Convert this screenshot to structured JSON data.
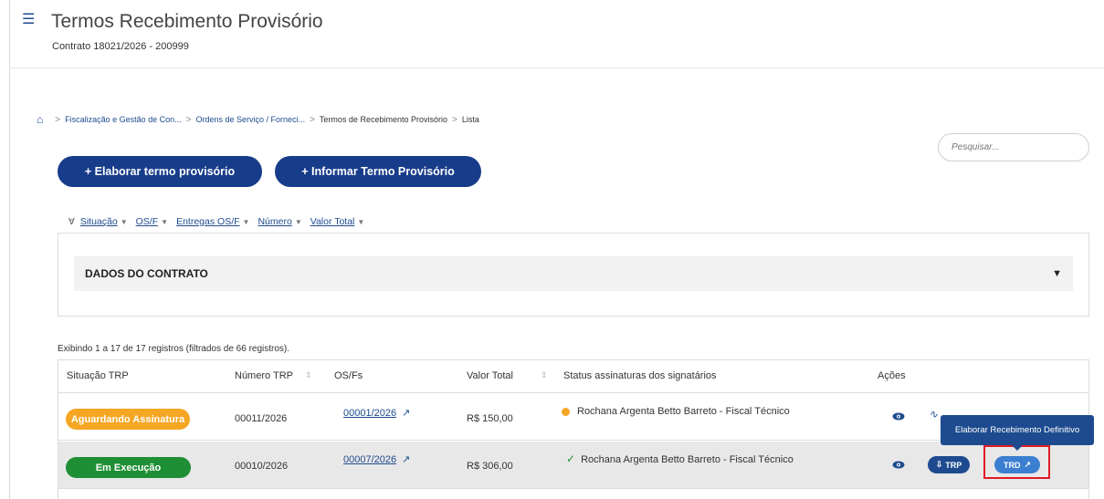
{
  "header": {
    "title": "Termos Recebimento Provisório",
    "subtitle": "Contrato 18021/2026 - 200999"
  },
  "breadcrumb": {
    "items": [
      "Fiscalização e Gestão de Con...",
      "Ordens de Serviço / Forneci...",
      "Termos de Recebimento Provisório",
      "Lista"
    ]
  },
  "search": {
    "placeholder": "Pesquisar..."
  },
  "actions": {
    "elaborar": "+ Elaborar termo provisório",
    "informar": "+ Informar Termo Provisório"
  },
  "filters": [
    "Situação",
    "OS/F",
    "Entregas OS/F",
    "Número",
    "Valor Total"
  ],
  "panel": {
    "title": "DADOS DO CONTRATO"
  },
  "table": {
    "count_text": "Exibindo 1 a 17 de 17 registros (filtrados de 66 registros).",
    "headers": {
      "situacao": "Situação TRP",
      "numero": "Número TRP",
      "osfs": "OS/Fs",
      "valor": "Valor Total",
      "status": "Status assinaturas dos signatários",
      "acoes": "Ações"
    },
    "rows": [
      {
        "situacao": "Aguardando Assinatura",
        "numero": "00011/2026",
        "os": "00001/2026",
        "valor": "R$ 150,00",
        "status": "Rochana Argenta Betto Barreto - Fiscal Técnico",
        "status_icon": "warning-dot"
      },
      {
        "situacao": "Em Execução",
        "numero": "00010/2026",
        "os": "00007/2026",
        "valor": "R$ 306,00",
        "status": "Rochana Argenta Betto Barreto - Fiscal Técnico",
        "status_icon": "check-icon",
        "trp_label": "TRP",
        "trd_label": "TRD"
      }
    ]
  },
  "tooltip": {
    "text": "Elaborar Recebimento Definitivo"
  },
  "colors": {
    "primary": "#173c8a",
    "orange": "#f5a623",
    "green": "#1e8f35",
    "highlight": "#e01b24"
  }
}
